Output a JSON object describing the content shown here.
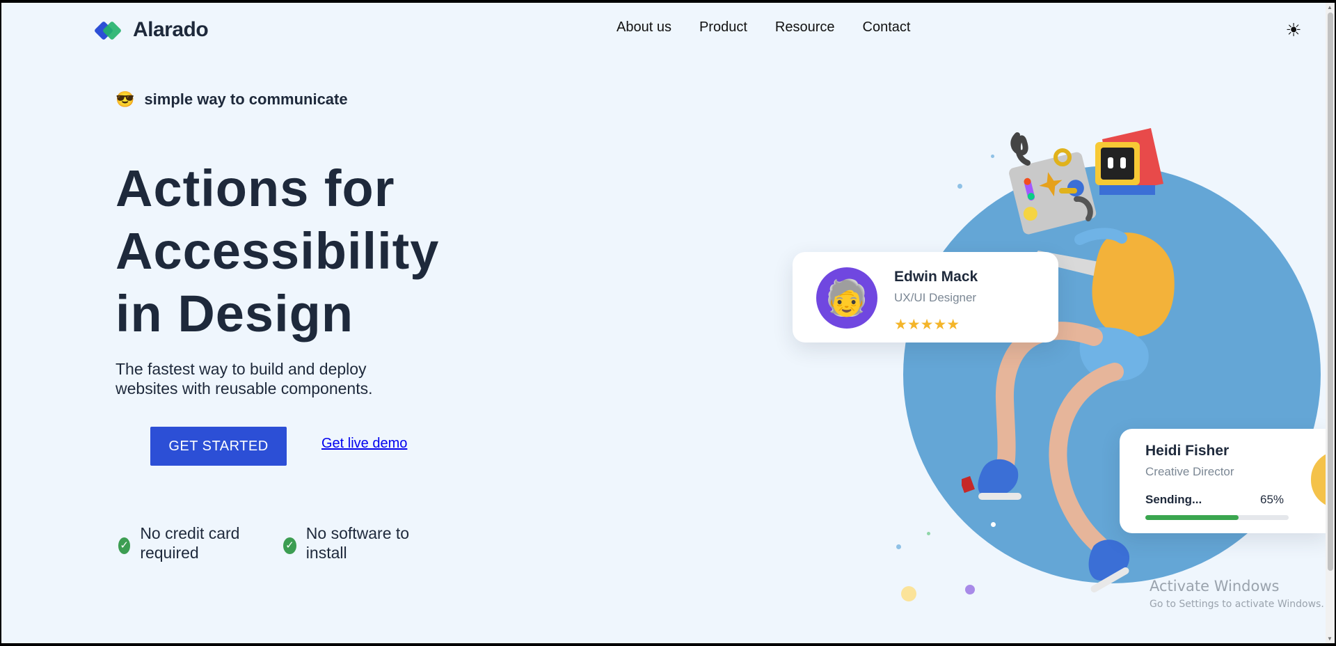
{
  "brand": {
    "name": "Alarado"
  },
  "nav": {
    "items": [
      "About us",
      "Product",
      "Resource",
      "Contact"
    ]
  },
  "theme_toggle": {
    "icon": "sun-icon",
    "glyph": "☀"
  },
  "hero": {
    "tagline_emoji": "😎",
    "tagline": "simple way to communicate",
    "headline_line1": "Actions for",
    "headline_line2": "Accessibility",
    "headline_line3": "in Design",
    "subtext": "The fastest way to build and deploy websites with reusable components.",
    "cta_label": "GET STARTED",
    "demo_label": "Get live demo",
    "features": [
      "No credit card required",
      "No software to install"
    ]
  },
  "profile_card": {
    "name": "Edwin Mack",
    "role": "UX/UI Designer",
    "avatar_emoji": "🧓",
    "stars": "★★★★★",
    "rating": 5
  },
  "sending_card": {
    "name": "Heidi Fisher",
    "role": "Creative Director",
    "status_label": "Sending...",
    "progress_label": "65%",
    "progress": 0.65
  },
  "watermark": {
    "line1": "Activate Windows",
    "line2": "Go to Settings to activate Windows."
  },
  "colors": {
    "background": "#eff6fd",
    "primary": "#2c4fd6",
    "accent_green": "#3c9d52",
    "circle": "#64a6d6",
    "star": "#f4b52a",
    "text": "#1e293b"
  }
}
